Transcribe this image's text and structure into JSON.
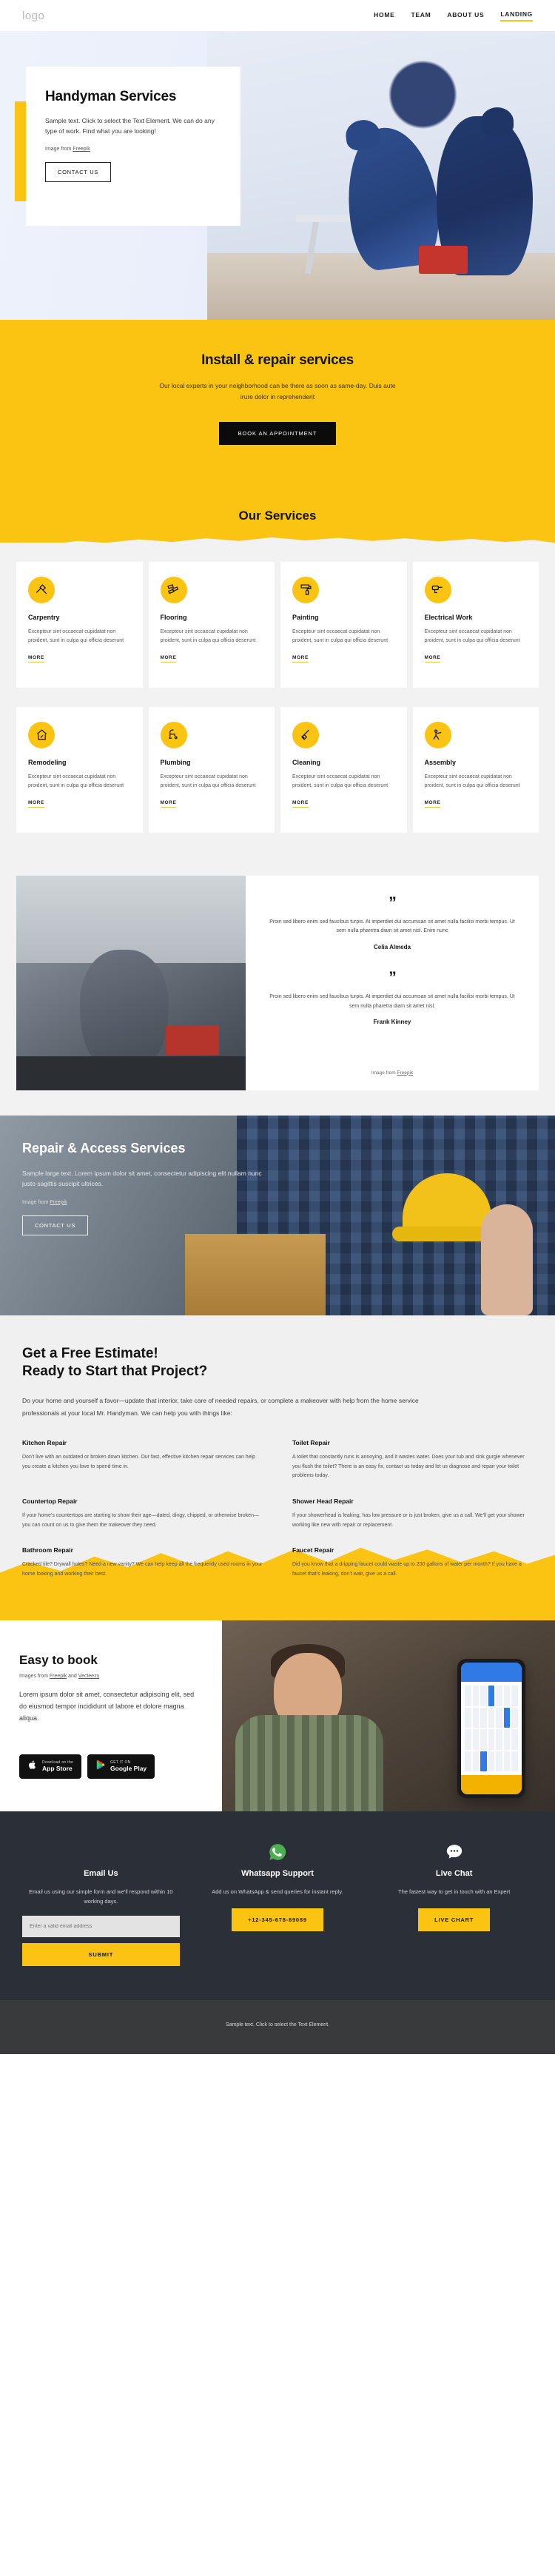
{
  "nav": {
    "logo": "logo",
    "links": [
      {
        "label": "HOME",
        "active": false
      },
      {
        "label": "TEAM",
        "active": false
      },
      {
        "label": "ABOUT US",
        "active": false
      },
      {
        "label": "LANDING",
        "active": true
      }
    ]
  },
  "hero": {
    "title": "Handyman Services",
    "subtitle": "Sample text. Click to select the Text Element. We can do any type of work. Find what you are looking!",
    "credit_prefix": "Image from ",
    "credit_link": "Freepik",
    "cta": "CONTACT US"
  },
  "band": {
    "title": "Install & repair services",
    "subtitle": "Our local experts in your neighborhood can be there as soon as same-day. Duis aute irure dolor in reprehenderit",
    "cta": "BOOK AN APPOINTMENT"
  },
  "services": {
    "heading": "Our Services",
    "more_label": "MORE",
    "body": "Excepteur sint occaecat cupidatat non proident, sunt in culpa qui officia deserunt",
    "items": [
      {
        "title": "Carpentry",
        "icon": "hammer-saw-icon"
      },
      {
        "title": "Flooring",
        "icon": "parquet-icon"
      },
      {
        "title": "Painting",
        "icon": "paint-roller-icon"
      },
      {
        "title": "Electrical Work",
        "icon": "drill-icon"
      },
      {
        "title": "Remodeling",
        "icon": "house-repair-icon"
      },
      {
        "title": "Plumbing",
        "icon": "faucet-icon"
      },
      {
        "title": "Cleaning",
        "icon": "broom-icon"
      },
      {
        "title": "Assembly",
        "icon": "assembly-icon"
      }
    ]
  },
  "testimonials": {
    "quote_glyph": "”",
    "credit_prefix": "Image from ",
    "credit_link": "Freepik",
    "items": [
      {
        "text": "Proin sed libero enim sed faucibus turpis. At imperdiet dui accumsan sit amet nulla facilisi morbi tempus. Ut sem nulla pharetra diam sit amet nisl. Enim nunc",
        "name": "Celia Almeda"
      },
      {
        "text": "Proin sed libero enim sed faucibus turpis. At imperdiet dui accumsan sit amet nulla facilisi morbi tempus. Ut sem nulla pharetra diam sit amet nisl.",
        "name": "Frank Kinney"
      }
    ]
  },
  "access": {
    "title": "Repair & Access Services",
    "subtitle": "Sample large text. Lorem ipsum dolor sit amet, consectetur adipiscing elit nullam nunc justo sagittis suscipit ultrices.",
    "credit_prefix": "Image from ",
    "credit_link": "Freepik",
    "cta": "CONTACT US"
  },
  "estimate": {
    "title_line1": "Get a Free Estimate!",
    "title_line2": "Ready to Start that Project?",
    "lead": "Do your home and yourself a favor—update that interior, take care of needed repairs, or complete a makeover with help from the home service professionals at your local Mr. Handyman. We can help you with things like:",
    "items": [
      {
        "title": "Kitchen Repair",
        "text": "Don’t live with an outdated or broken down kitchen. Our fast, effective kitchen repair services can help you create a kitchen you love to spend time in."
      },
      {
        "title": "Toilet Repair",
        "text": "A toilet that constantly runs is annoying, and it wastes water. Does your tub and sink gurgle whenever you flush the toilet? There is an easy fix, contact us today and let us diagnose and repair your toilet problems today."
      },
      {
        "title": "Countertop Repair",
        "text": "If your home’s countertops are starting to show their age—dated, dingy, chipped, or otherwise broken—you can count on us to give them the makeover they need."
      },
      {
        "title": "Shower Head Repair",
        "text": "If your showerhead is leaking, has low pressure or is just broken, give us a call. We’ll get your shower working like new with repair or replacement."
      },
      {
        "title": "Bathroom Repair",
        "text": "Cracked tile? Drywall holes? Need a new vanity? We can help keep all the frequently used rooms in your home looking and working their best."
      },
      {
        "title": "Faucet Repair",
        "text": "Did you know that a dripping faucet could waste up to 200 gallons of water per month? If you have a faucet that’s leaking, don’t wait, give us a call."
      }
    ]
  },
  "booking": {
    "title": "Easy to book",
    "credit_prefix": "Images from ",
    "credit_link1": "Freepik",
    "credit_mid": " and ",
    "credit_link2": "Vecteezy",
    "body": "Lorem ipsum dolor sit amet, consectetur adipiscing elit, sed do eiusmod tempor incididunt ut labore et dolore magna aliqua.",
    "stores": [
      {
        "small": "Download on the",
        "big": "App Store",
        "icon": "apple-icon"
      },
      {
        "small": "GET IT ON",
        "big": "Google Play",
        "icon": "google-play-icon"
      }
    ]
  },
  "footer": {
    "columns": [
      {
        "title": "Email Us",
        "text": "Email us using our simple form and we'll respond within 10 working days.",
        "placeholder": "Enter a valid email address",
        "button": "SUBMIT",
        "icon": ""
      },
      {
        "title": "Whatsapp Support",
        "text": "Add us on WhatsApp & send queries for instant reply.",
        "button": "+12-345-678-89089",
        "icon": "whatsapp-icon"
      },
      {
        "title": "Live Chat",
        "text": "The fastest way to get in touch with an Expert",
        "button": "LIVE CHART",
        "icon": "chat-bubble-icon"
      }
    ],
    "copyright": "Sample text. Click to select the Text Element."
  },
  "colors": {
    "yellow": "#fbc412",
    "dark": "#2b2f37",
    "whatsapp_green": "#4caf50"
  }
}
